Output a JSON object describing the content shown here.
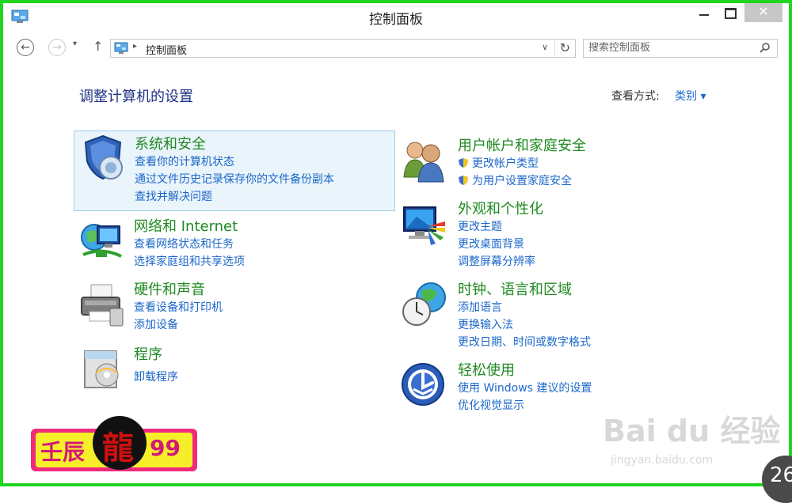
{
  "window": {
    "title": "控制面板",
    "close_label": "✕"
  },
  "nav": {
    "back_glyph": "←",
    "forward_glyph": "→",
    "recent_glyph": "▾",
    "up_glyph": "↑",
    "breadcrumb_sep": "▸",
    "address_text": "控制面板",
    "address_dropdown": "∨",
    "refresh_glyph": "↻"
  },
  "search": {
    "placeholder": "搜索控制面板"
  },
  "main": {
    "heading": "调整计算机的设置",
    "view_by_label": "查看方式:",
    "view_by_value": "类别 ▾"
  },
  "categories": [
    {
      "title": "系统和安全",
      "links": [
        "查看你的计算机状态",
        "通过文件历史记录保存你的文件备份副本",
        "查找并解决问题"
      ],
      "icon": "shield-icon"
    },
    {
      "title": "网络和 Internet",
      "links": [
        "查看网络状态和任务",
        "选择家庭组和共享选项"
      ],
      "icon": "network-icon"
    },
    {
      "title": "硬件和声音",
      "links": [
        "查看设备和打印机",
        "添加设备"
      ],
      "icon": "printer-icon"
    },
    {
      "title": "程序",
      "links": [
        "卸载程序"
      ],
      "icon": "programs-icon"
    },
    {
      "title": "用户帐户和家庭安全",
      "links": [
        "更改帐户类型",
        "为用户设置家庭安全"
      ],
      "icon": "users-icon"
    },
    {
      "title": "外观和个性化",
      "links": [
        "更改主题",
        "更改桌面背景",
        "调整屏幕分辨率"
      ],
      "icon": "monitor-icon"
    },
    {
      "title": "时钟、语言和区域",
      "links": [
        "添加语言",
        "更换输入法",
        "更改日期、时间或数字格式"
      ],
      "icon": "clock-globe-icon"
    },
    {
      "title": "轻松使用",
      "links": [
        "使用 Windows 建议的设置",
        "优化视觉显示"
      ],
      "icon": "ease-of-access-icon"
    }
  ],
  "overlay": {
    "logo_text_left": "壬辰",
    "logo_char": "龍",
    "logo_text_right": "99",
    "watermark_big": "Bai du 经验",
    "watermark_small": "jingyan.baidu.com",
    "page_number": "26"
  },
  "colors": {
    "frame_border": "#22d422",
    "category_title": "#1f8a20",
    "link": "#1b67c9",
    "heading": "#1e3287",
    "highlight_bg": "#eaf4fb"
  }
}
